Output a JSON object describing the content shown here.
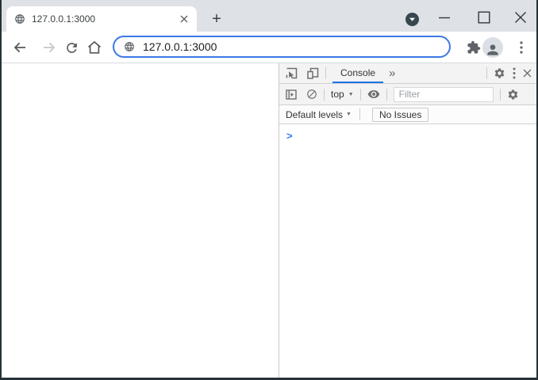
{
  "tab_strip": {
    "tab": {
      "title": "127.0.0.1:3000"
    },
    "new_tab_glyph": "+"
  },
  "toolbar": {
    "url": "127.0.0.1:3000"
  },
  "devtools": {
    "tab_bar": {
      "active_tab": "Console",
      "more_tabs_glyph": "»"
    },
    "console_toolbar": {
      "context_selector": "top",
      "context_caret": "▼",
      "filter_placeholder": "Filter"
    },
    "levels_bar": {
      "levels_selector": "Default levels",
      "levels_caret": "▼",
      "no_issues_label": "No Issues"
    },
    "prompt_glyph": ">"
  },
  "icons": {
    "tab": [
      "globe-icon",
      "close-icon"
    ],
    "tab_strip": [
      "new-tab-icon",
      "tab-search-icon",
      "minimize-icon",
      "maximize-icon",
      "close-icon"
    ],
    "toolbar": [
      "back-icon",
      "forward-icon",
      "reload-icon",
      "home-icon",
      "globe-icon",
      "extensions-puzzle-icon",
      "avatar-icon",
      "kebab-menu-icon"
    ],
    "devtools": [
      "inspect-icon",
      "device-toolbar-icon",
      "settings-gear-icon",
      "kebab-menu-icon",
      "close-icon",
      "console-sidebar-icon",
      "clear-console-icon",
      "eye-icon"
    ]
  },
  "colors": {
    "frame_dark": "#263238",
    "tab_strip_bg": "#dee1e6",
    "accent_blue": "#1a73e8",
    "omnibox_focus_ring": "#3b78e7",
    "devtools_toolbar_bg": "#f3f3f3",
    "icon_gray": "#5f6368",
    "prompt_blue": "#2e7bf6"
  }
}
